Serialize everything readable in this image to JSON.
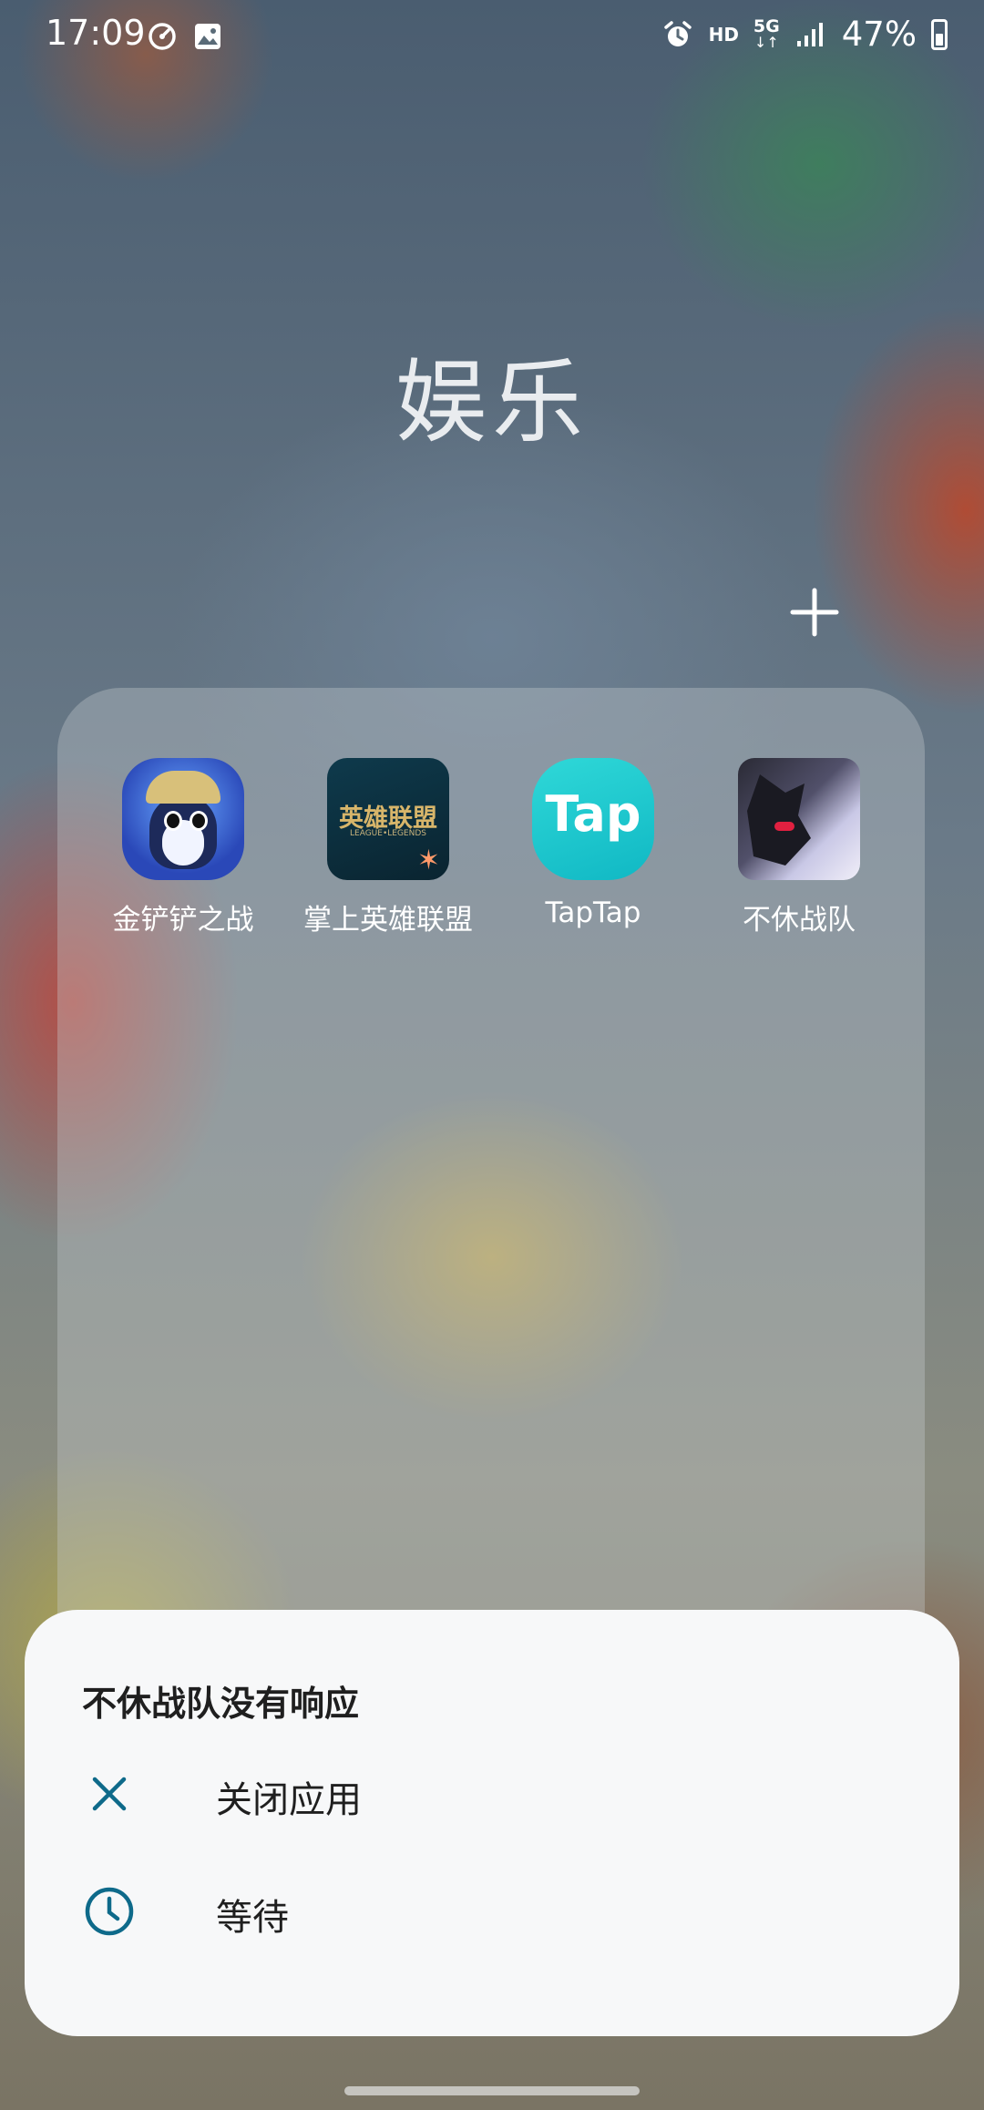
{
  "status_bar": {
    "time": "17:09",
    "left_icons": [
      "speedometer-icon",
      "gallery-icon"
    ],
    "right_icons": [
      "alarm-icon",
      "hd-icon",
      "5g-icon",
      "signal-icon"
    ],
    "hd_label": "HD",
    "network_label": "5G",
    "battery_percent": "47%"
  },
  "folder": {
    "title": "娱乐",
    "apps": [
      {
        "label": "金铲铲之战",
        "icon": "jinchanchan-app-icon"
      },
      {
        "label": "掌上英雄联盟",
        "icon": "lol-app-icon",
        "icon_text": "英雄联盟",
        "icon_subtext": "LEAGUE•LEGENDS"
      },
      {
        "label": "TapTap",
        "icon": "taptap-app-icon",
        "icon_text": "Tap"
      },
      {
        "label": "不休战队",
        "icon": "buxiuzhandui-app-icon"
      }
    ]
  },
  "dialog": {
    "title": "不休战队没有响应",
    "options": [
      {
        "label": "关闭应用",
        "icon": "close-icon"
      },
      {
        "label": "等待",
        "icon": "clock-icon"
      }
    ],
    "accent_color": "#0e6a8a"
  }
}
